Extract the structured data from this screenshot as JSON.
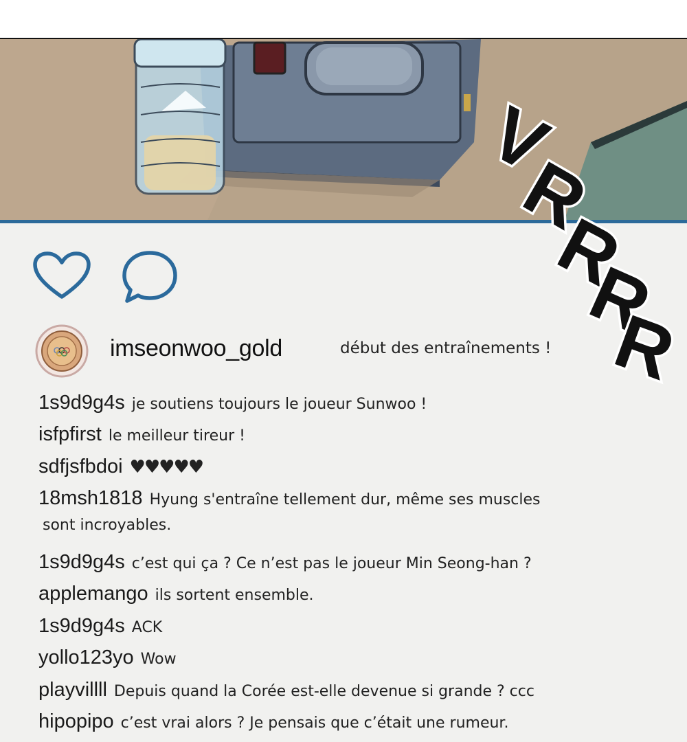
{
  "post": {
    "username": "imseonwoo_gold",
    "caption": "début des entraînements !",
    "actions": {
      "like_icon": "heart-outline-icon",
      "comment_icon": "speech-bubble-icon"
    },
    "accent_color": "#2c6a9a"
  },
  "sound_effect": "VRRRR",
  "comments": [
    {
      "user": "1s9d9g4s",
      "text": "je soutiens toujours le joueur Sunwoo !"
    },
    {
      "user": "isfpfirst",
      "text": "le meilleur tireur !"
    },
    {
      "user": "sdfjsfbdoi",
      "text": "♥♥♥♥♥"
    },
    {
      "user": "18msh1818",
      "text": "Hyung s'entraîne tellement dur, même ses muscles",
      "continuation": "sont incroyables."
    },
    {
      "user": "1s9d9g4s",
      "text": "c’est qui ça ? Ce n’est pas le joueur Min Seong-han ?"
    },
    {
      "user": "applemango",
      "text": "ils sortent ensemble."
    },
    {
      "user": "1s9d9g4s",
      "text": "ACK"
    },
    {
      "user": "yollo123yo",
      "text": "Wow"
    },
    {
      "user": "playvillll",
      "text": "Depuis quand la Corée est-elle devenue si grande ? ccc"
    },
    {
      "user": "hipopipo",
      "text": "c’est vrai alors ? Je pensais que c’était une rumeur."
    }
  ]
}
